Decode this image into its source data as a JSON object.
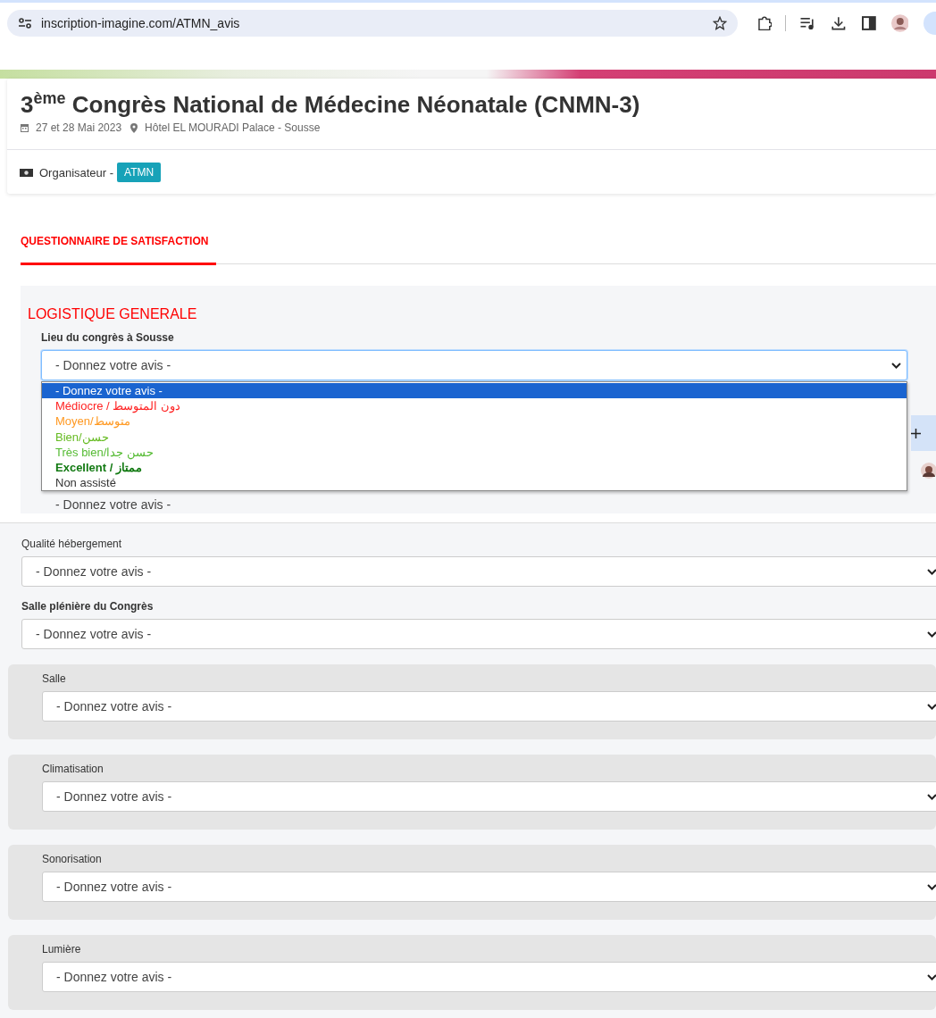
{
  "browser": {
    "url": "inscription-imagine.com/ATMN_avis"
  },
  "event": {
    "title": "3$^{ème}$ Congrès National de Médecine Néonatale (CNMN-3)",
    "date": "27 et 28 Mai 2023",
    "place": "Hôtel EL MOURADI Palace - Sousse",
    "organiser_label": "Organisateur -",
    "organiser": "ATMN"
  },
  "tabs": [
    {
      "label": "QUESTIONNAIRE DE SATISFACTION",
      "selected": true
    }
  ],
  "section": {
    "title": "LOGISTIQUE GENERALE",
    "open_field": {
      "label": "Lieu du congrès à Sousse",
      "value": "- Donnez votre avis -",
      "options": [
        {
          "label": "- Donnez votre avis -",
          "bold": false,
          "selected": true
        },
        {
          "label": "Médiocre / دون المتوسط",
          "color": "#ff2222",
          "bold": false,
          "selected": false
        },
        {
          "label": "Moyen/متوسط",
          "color": "#ff9922",
          "bold": false,
          "selected": false
        },
        {
          "label": "Bien/حسن",
          "color": "#66bb22",
          "bold": false,
          "selected": false
        },
        {
          "label": "Très bien/حسن جدا",
          "color": "#55bb33",
          "bold": false,
          "selected": false
        },
        {
          "label": "Excellent / ممتاز",
          "color": "#137a13",
          "bold": true,
          "selected": false
        },
        {
          "label": "Non assisté",
          "bold": false,
          "selected": false
        }
      ],
      "next_value": "- Donnez votre avis -"
    }
  },
  "fields": [
    {
      "kind": "field",
      "label": "Qualité hébergement",
      "value": "- Donnez votre avis -"
    },
    {
      "kind": "heading",
      "label": "Salle plénière du Congrès",
      "value": "- Donnez votre avis -"
    },
    {
      "kind": "sub",
      "label": "Salle",
      "value": "- Donnez votre avis -"
    },
    {
      "kind": "sub",
      "label": "Climatisation",
      "value": "- Donnez votre avis -"
    },
    {
      "kind": "sub",
      "label": "Sonorisation",
      "value": "- Donnez votre avis -"
    },
    {
      "kind": "sub",
      "label": "Lumière",
      "value": "- Donnez votre avis -"
    }
  ]
}
